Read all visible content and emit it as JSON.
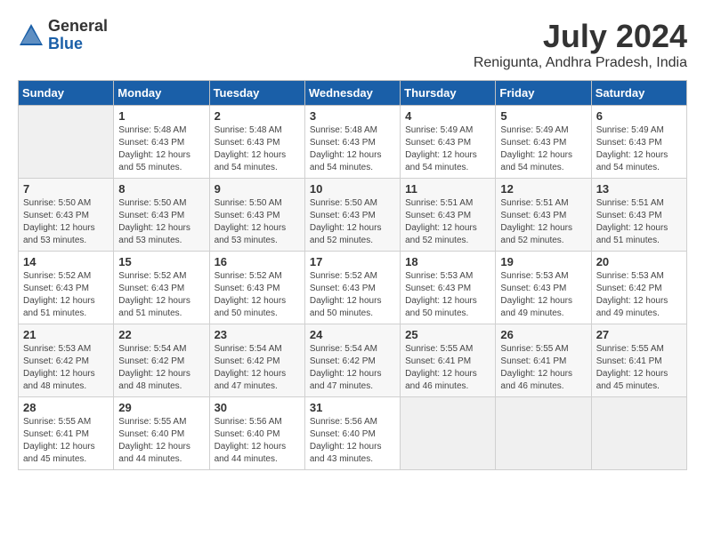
{
  "logo": {
    "general": "General",
    "blue": "Blue"
  },
  "title": "July 2024",
  "location": "Renigunta, Andhra Pradesh, India",
  "days_header": [
    "Sunday",
    "Monday",
    "Tuesday",
    "Wednesday",
    "Thursday",
    "Friday",
    "Saturday"
  ],
  "weeks": [
    [
      {
        "day": "",
        "sunrise": "",
        "sunset": "",
        "daylight": ""
      },
      {
        "day": "1",
        "sunrise": "Sunrise: 5:48 AM",
        "sunset": "Sunset: 6:43 PM",
        "daylight": "Daylight: 12 hours and 55 minutes."
      },
      {
        "day": "2",
        "sunrise": "Sunrise: 5:48 AM",
        "sunset": "Sunset: 6:43 PM",
        "daylight": "Daylight: 12 hours and 54 minutes."
      },
      {
        "day": "3",
        "sunrise": "Sunrise: 5:48 AM",
        "sunset": "Sunset: 6:43 PM",
        "daylight": "Daylight: 12 hours and 54 minutes."
      },
      {
        "day": "4",
        "sunrise": "Sunrise: 5:49 AM",
        "sunset": "Sunset: 6:43 PM",
        "daylight": "Daylight: 12 hours and 54 minutes."
      },
      {
        "day": "5",
        "sunrise": "Sunrise: 5:49 AM",
        "sunset": "Sunset: 6:43 PM",
        "daylight": "Daylight: 12 hours and 54 minutes."
      },
      {
        "day": "6",
        "sunrise": "Sunrise: 5:49 AM",
        "sunset": "Sunset: 6:43 PM",
        "daylight": "Daylight: 12 hours and 54 minutes."
      }
    ],
    [
      {
        "day": "7",
        "sunrise": "Sunrise: 5:50 AM",
        "sunset": "Sunset: 6:43 PM",
        "daylight": "Daylight: 12 hours and 53 minutes."
      },
      {
        "day": "8",
        "sunrise": "Sunrise: 5:50 AM",
        "sunset": "Sunset: 6:43 PM",
        "daylight": "Daylight: 12 hours and 53 minutes."
      },
      {
        "day": "9",
        "sunrise": "Sunrise: 5:50 AM",
        "sunset": "Sunset: 6:43 PM",
        "daylight": "Daylight: 12 hours and 53 minutes."
      },
      {
        "day": "10",
        "sunrise": "Sunrise: 5:50 AM",
        "sunset": "Sunset: 6:43 PM",
        "daylight": "Daylight: 12 hours and 52 minutes."
      },
      {
        "day": "11",
        "sunrise": "Sunrise: 5:51 AM",
        "sunset": "Sunset: 6:43 PM",
        "daylight": "Daylight: 12 hours and 52 minutes."
      },
      {
        "day": "12",
        "sunrise": "Sunrise: 5:51 AM",
        "sunset": "Sunset: 6:43 PM",
        "daylight": "Daylight: 12 hours and 52 minutes."
      },
      {
        "day": "13",
        "sunrise": "Sunrise: 5:51 AM",
        "sunset": "Sunset: 6:43 PM",
        "daylight": "Daylight: 12 hours and 51 minutes."
      }
    ],
    [
      {
        "day": "14",
        "sunrise": "Sunrise: 5:52 AM",
        "sunset": "Sunset: 6:43 PM",
        "daylight": "Daylight: 12 hours and 51 minutes."
      },
      {
        "day": "15",
        "sunrise": "Sunrise: 5:52 AM",
        "sunset": "Sunset: 6:43 PM",
        "daylight": "Daylight: 12 hours and 51 minutes."
      },
      {
        "day": "16",
        "sunrise": "Sunrise: 5:52 AM",
        "sunset": "Sunset: 6:43 PM",
        "daylight": "Daylight: 12 hours and 50 minutes."
      },
      {
        "day": "17",
        "sunrise": "Sunrise: 5:52 AM",
        "sunset": "Sunset: 6:43 PM",
        "daylight": "Daylight: 12 hours and 50 minutes."
      },
      {
        "day": "18",
        "sunrise": "Sunrise: 5:53 AM",
        "sunset": "Sunset: 6:43 PM",
        "daylight": "Daylight: 12 hours and 50 minutes."
      },
      {
        "day": "19",
        "sunrise": "Sunrise: 5:53 AM",
        "sunset": "Sunset: 6:43 PM",
        "daylight": "Daylight: 12 hours and 49 minutes."
      },
      {
        "day": "20",
        "sunrise": "Sunrise: 5:53 AM",
        "sunset": "Sunset: 6:42 PM",
        "daylight": "Daylight: 12 hours and 49 minutes."
      }
    ],
    [
      {
        "day": "21",
        "sunrise": "Sunrise: 5:53 AM",
        "sunset": "Sunset: 6:42 PM",
        "daylight": "Daylight: 12 hours and 48 minutes."
      },
      {
        "day": "22",
        "sunrise": "Sunrise: 5:54 AM",
        "sunset": "Sunset: 6:42 PM",
        "daylight": "Daylight: 12 hours and 48 minutes."
      },
      {
        "day": "23",
        "sunrise": "Sunrise: 5:54 AM",
        "sunset": "Sunset: 6:42 PM",
        "daylight": "Daylight: 12 hours and 47 minutes."
      },
      {
        "day": "24",
        "sunrise": "Sunrise: 5:54 AM",
        "sunset": "Sunset: 6:42 PM",
        "daylight": "Daylight: 12 hours and 47 minutes."
      },
      {
        "day": "25",
        "sunrise": "Sunrise: 5:55 AM",
        "sunset": "Sunset: 6:41 PM",
        "daylight": "Daylight: 12 hours and 46 minutes."
      },
      {
        "day": "26",
        "sunrise": "Sunrise: 5:55 AM",
        "sunset": "Sunset: 6:41 PM",
        "daylight": "Daylight: 12 hours and 46 minutes."
      },
      {
        "day": "27",
        "sunrise": "Sunrise: 5:55 AM",
        "sunset": "Sunset: 6:41 PM",
        "daylight": "Daylight: 12 hours and 45 minutes."
      }
    ],
    [
      {
        "day": "28",
        "sunrise": "Sunrise: 5:55 AM",
        "sunset": "Sunset: 6:41 PM",
        "daylight": "Daylight: 12 hours and 45 minutes."
      },
      {
        "day": "29",
        "sunrise": "Sunrise: 5:55 AM",
        "sunset": "Sunset: 6:40 PM",
        "daylight": "Daylight: 12 hours and 44 minutes."
      },
      {
        "day": "30",
        "sunrise": "Sunrise: 5:56 AM",
        "sunset": "Sunset: 6:40 PM",
        "daylight": "Daylight: 12 hours and 44 minutes."
      },
      {
        "day": "31",
        "sunrise": "Sunrise: 5:56 AM",
        "sunset": "Sunset: 6:40 PM",
        "daylight": "Daylight: 12 hours and 43 minutes."
      },
      {
        "day": "",
        "sunrise": "",
        "sunset": "",
        "daylight": ""
      },
      {
        "day": "",
        "sunrise": "",
        "sunset": "",
        "daylight": ""
      },
      {
        "day": "",
        "sunrise": "",
        "sunset": "",
        "daylight": ""
      }
    ]
  ]
}
